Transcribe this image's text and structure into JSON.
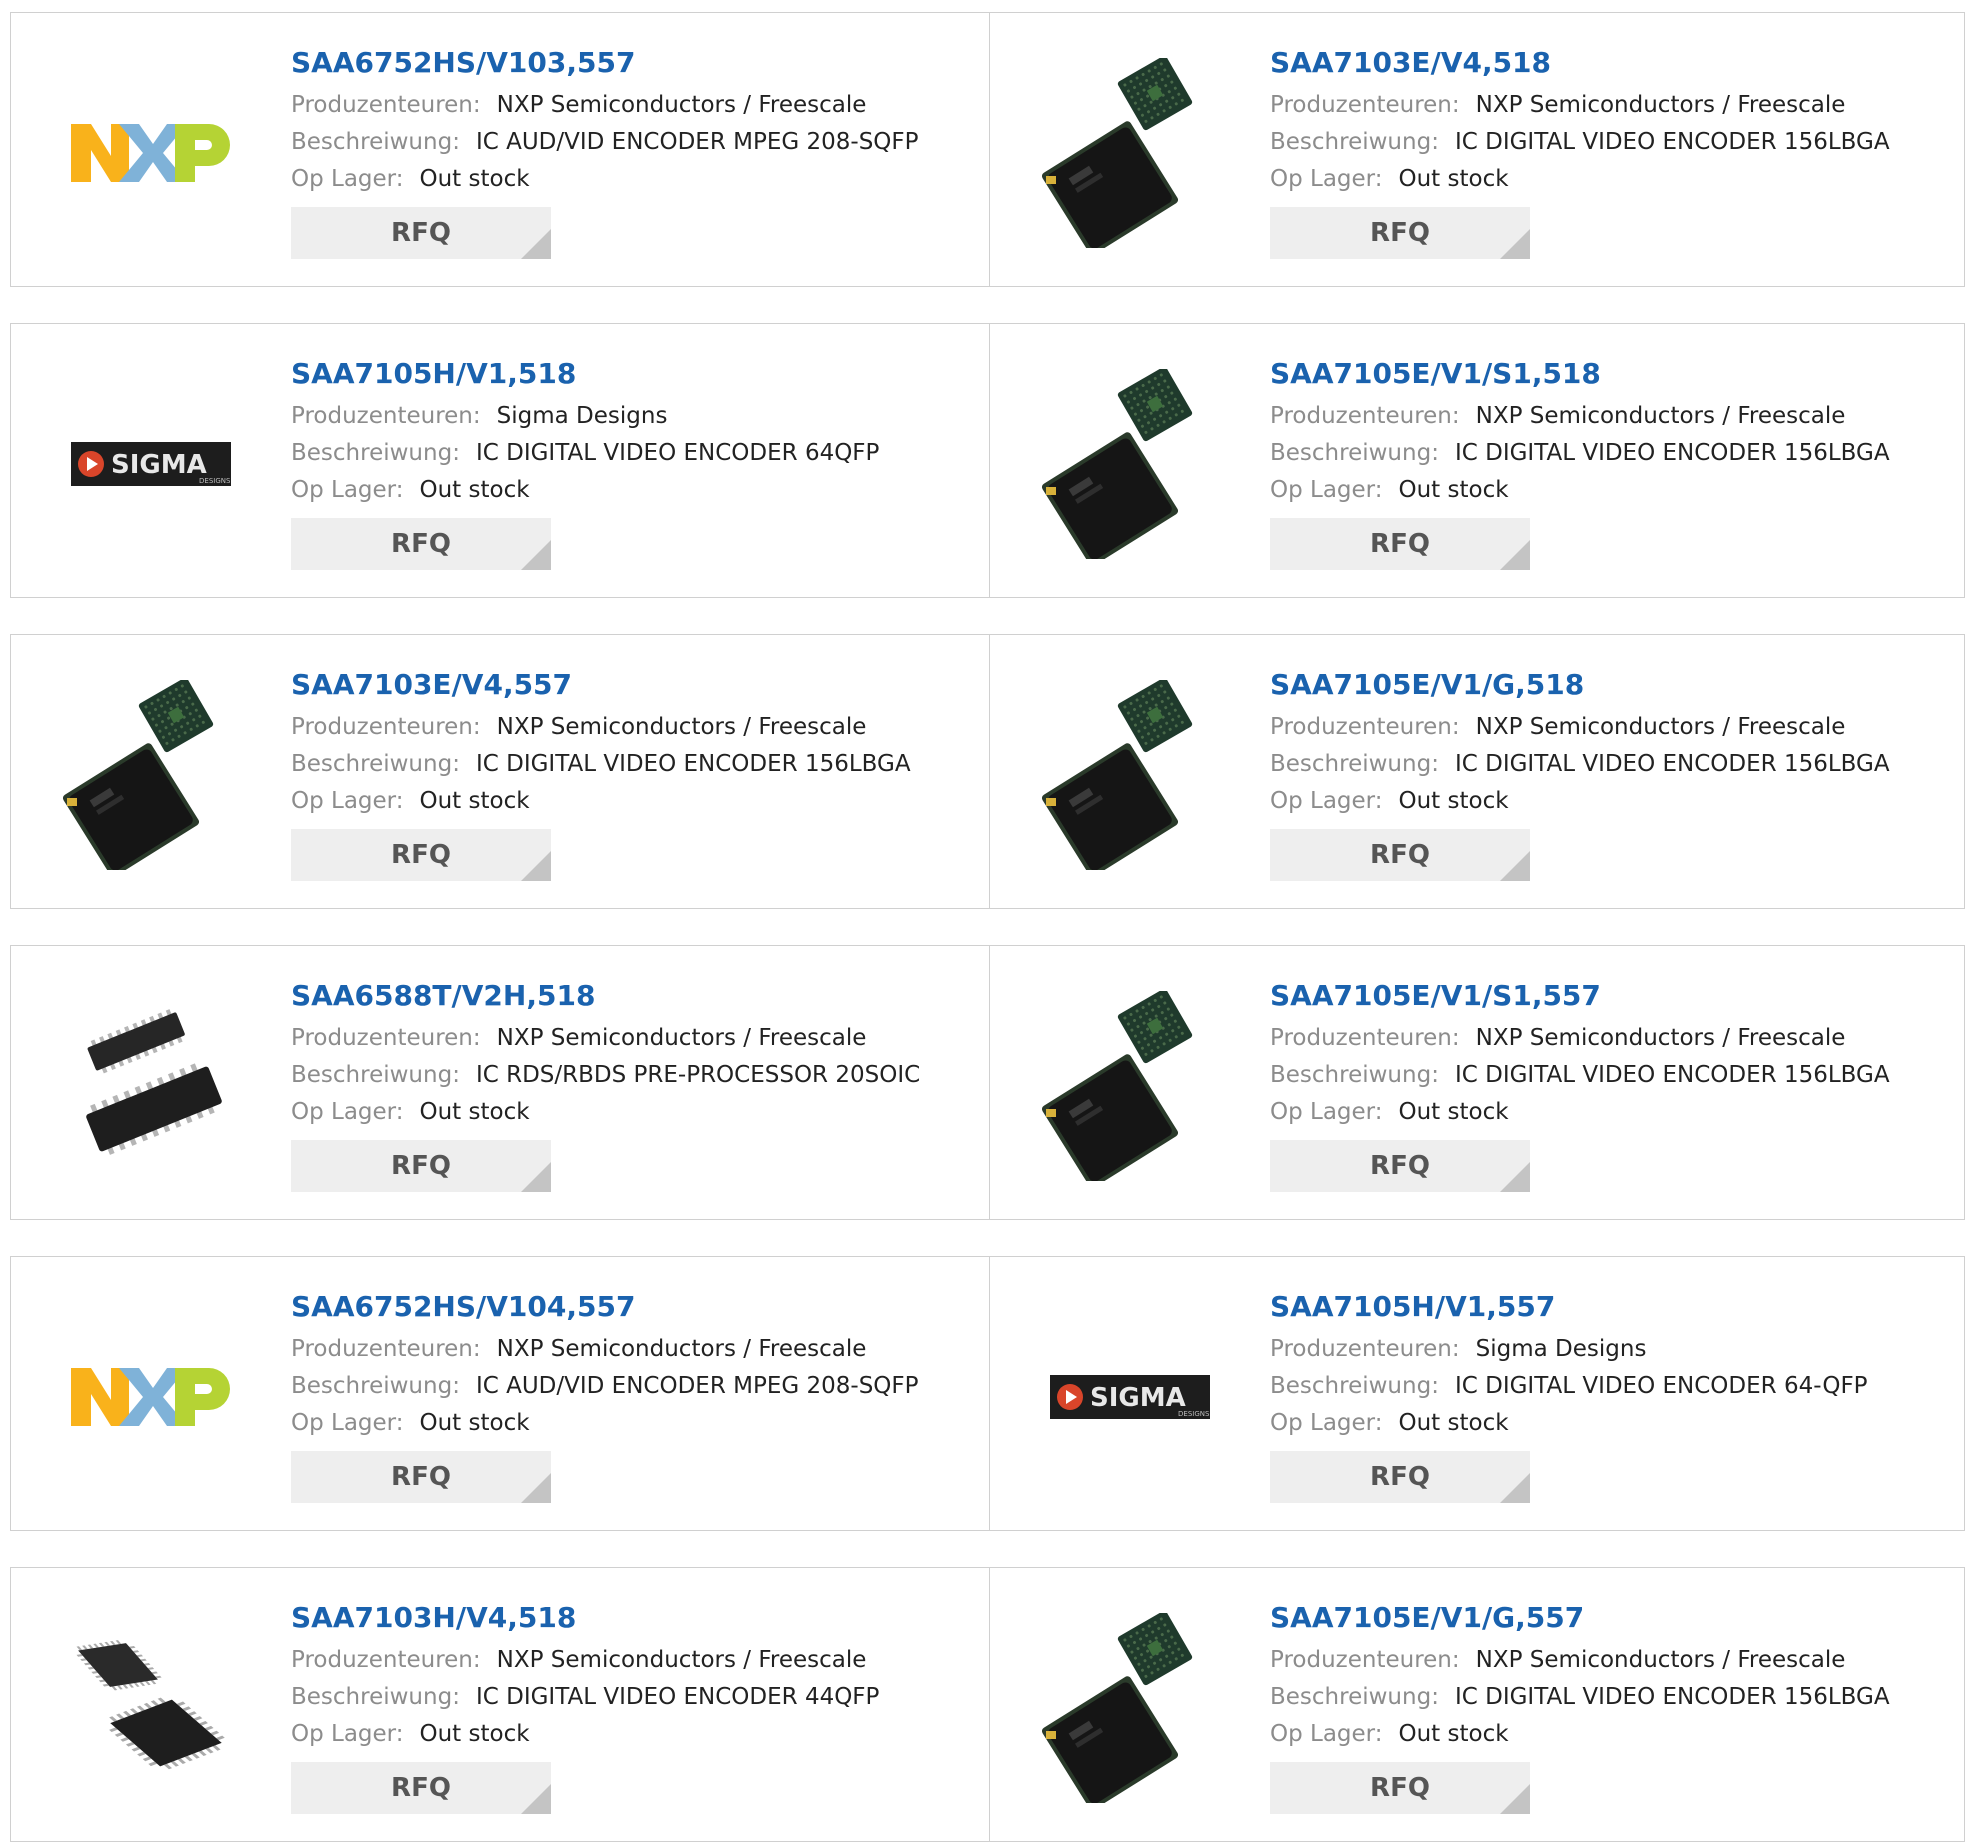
{
  "labels": {
    "manufacturer": "Produzenteuren:",
    "description": "Beschreiwung:",
    "stock": "Op Lager:",
    "rfq": "RFQ"
  },
  "products": [
    {
      "name": "SAA6752HS/V103,557",
      "manufacturer": "NXP Semiconductors / Freescale",
      "description": "IC AUD/VID ENCODER MPEG 208-SQFP",
      "stock": "Out stock",
      "image": "nxp-logo"
    },
    {
      "name": "SAA7103E/V4,518",
      "manufacturer": "NXP Semiconductors / Freescale",
      "description": "IC DIGITAL VIDEO ENCODER 156LBGA",
      "stock": "Out stock",
      "image": "bga-chip"
    },
    {
      "name": "SAA7105H/V1,518",
      "manufacturer": "Sigma Designs",
      "description": "IC DIGITAL VIDEO ENCODER 64QFP",
      "stock": "Out stock",
      "image": "sigma-logo"
    },
    {
      "name": "SAA7105E/V1/S1,518",
      "manufacturer": "NXP Semiconductors / Freescale",
      "description": "IC DIGITAL VIDEO ENCODER 156LBGA",
      "stock": "Out stock",
      "image": "bga-chip"
    },
    {
      "name": "SAA7103E/V4,557",
      "manufacturer": "NXP Semiconductors / Freescale",
      "description": "IC DIGITAL VIDEO ENCODER 156LBGA",
      "stock": "Out stock",
      "image": "bga-chip"
    },
    {
      "name": "SAA7105E/V1/G,518",
      "manufacturer": "NXP Semiconductors / Freescale",
      "description": "IC DIGITAL VIDEO ENCODER 156LBGA",
      "stock": "Out stock",
      "image": "bga-chip"
    },
    {
      "name": "SAA6588T/V2H,518",
      "manufacturer": "NXP Semiconductors / Freescale",
      "description": "IC RDS/RBDS PRE-PROCESSOR 20SOIC",
      "stock": "Out stock",
      "image": "soic-chip"
    },
    {
      "name": "SAA7105E/V1/S1,557",
      "manufacturer": "NXP Semiconductors / Freescale",
      "description": "IC DIGITAL VIDEO ENCODER 156LBGA",
      "stock": "Out stock",
      "image": "bga-chip"
    },
    {
      "name": "SAA6752HS/V104,557",
      "manufacturer": "NXP Semiconductors / Freescale",
      "description": "IC AUD/VID ENCODER MPEG 208-SQFP",
      "stock": "Out stock",
      "image": "nxp-logo"
    },
    {
      "name": "SAA7105H/V1,557",
      "manufacturer": "Sigma Designs",
      "description": "IC DIGITAL VIDEO ENCODER 64-QFP",
      "stock": "Out stock",
      "image": "sigma-logo"
    },
    {
      "name": "SAA7103H/V4,518",
      "manufacturer": "NXP Semiconductors / Freescale",
      "description": "IC DIGITAL VIDEO ENCODER 44QFP",
      "stock": "Out stock",
      "image": "qfp-chip"
    },
    {
      "name": "SAA7105E/V1/G,557",
      "manufacturer": "NXP Semiconductors / Freescale",
      "description": "IC DIGITAL VIDEO ENCODER 156LBGA",
      "stock": "Out stock",
      "image": "bga-chip"
    }
  ],
  "logos": {
    "nxp": {
      "letters": [
        "N",
        "X",
        "P"
      ],
      "colors": [
        "#f9b21b",
        "#7fb2d8",
        "#b5d334"
      ]
    },
    "sigma": {
      "text": "SIGMA",
      "subtext": "DESIGNS",
      "play_color": "#d9452a"
    }
  }
}
